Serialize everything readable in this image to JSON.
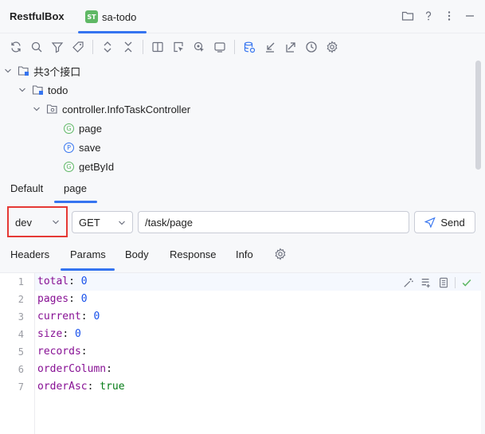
{
  "window": {
    "app_title": "RestfulBox",
    "tab_badge": "ST",
    "tab_label": "sa-todo"
  },
  "tree": {
    "root_label": "共3个接口",
    "module_label": "todo",
    "controller_label": "controller.InfoTaskController",
    "endpoints": [
      {
        "method": "G",
        "label": "page"
      },
      {
        "method": "P",
        "label": "save"
      },
      {
        "method": "G",
        "label": "getById"
      }
    ]
  },
  "request_tabs": [
    "Default",
    "page"
  ],
  "request": {
    "env": "dev",
    "method": "GET",
    "url": "/task/page",
    "send_label": "Send"
  },
  "param_tabs": [
    "Headers",
    "Params",
    "Body",
    "Response",
    "Info"
  ],
  "editor": {
    "lines": [
      {
        "num": "1",
        "key": "total",
        "value": "0"
      },
      {
        "num": "2",
        "key": "pages",
        "value": "0"
      },
      {
        "num": "3",
        "key": "current",
        "value": "0"
      },
      {
        "num": "4",
        "key": "size",
        "value": "0"
      },
      {
        "num": "5",
        "key": "records",
        "value": ""
      },
      {
        "num": "6",
        "key": "orderColumn",
        "value": ""
      },
      {
        "num": "7",
        "key": "orderAsc",
        "value": "true"
      }
    ]
  },
  "colors": {
    "accent": "#3574f0",
    "highlight_border": "#e53935",
    "get_badge": "#5fb865",
    "post_badge": "#3574f0"
  }
}
